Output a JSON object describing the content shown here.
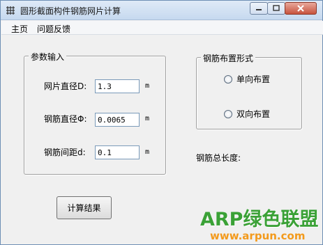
{
  "window": {
    "title": "圆形截面构件钢筋网片计算"
  },
  "menu": {
    "items": [
      "主页",
      "问题反馈"
    ]
  },
  "params_group": {
    "legend": "参数输入",
    "fields": [
      {
        "label": "网片直径D:",
        "value": "1.3",
        "unit": "m"
      },
      {
        "label": "钢筋直径Φ:",
        "value": "0.0065",
        "unit": "m"
      },
      {
        "label": "钢筋间距d:",
        "value": "0.1",
        "unit": "m"
      }
    ]
  },
  "layout_group": {
    "legend": "钢筋布置形式",
    "options": [
      "单向布置",
      "双向布置"
    ]
  },
  "result": {
    "total_length_label": "钢筋总长度:"
  },
  "actions": {
    "calculate_label": "计算结果"
  },
  "watermark": {
    "brand": "ARP绿色联盟",
    "url": "www.arpun.com"
  }
}
